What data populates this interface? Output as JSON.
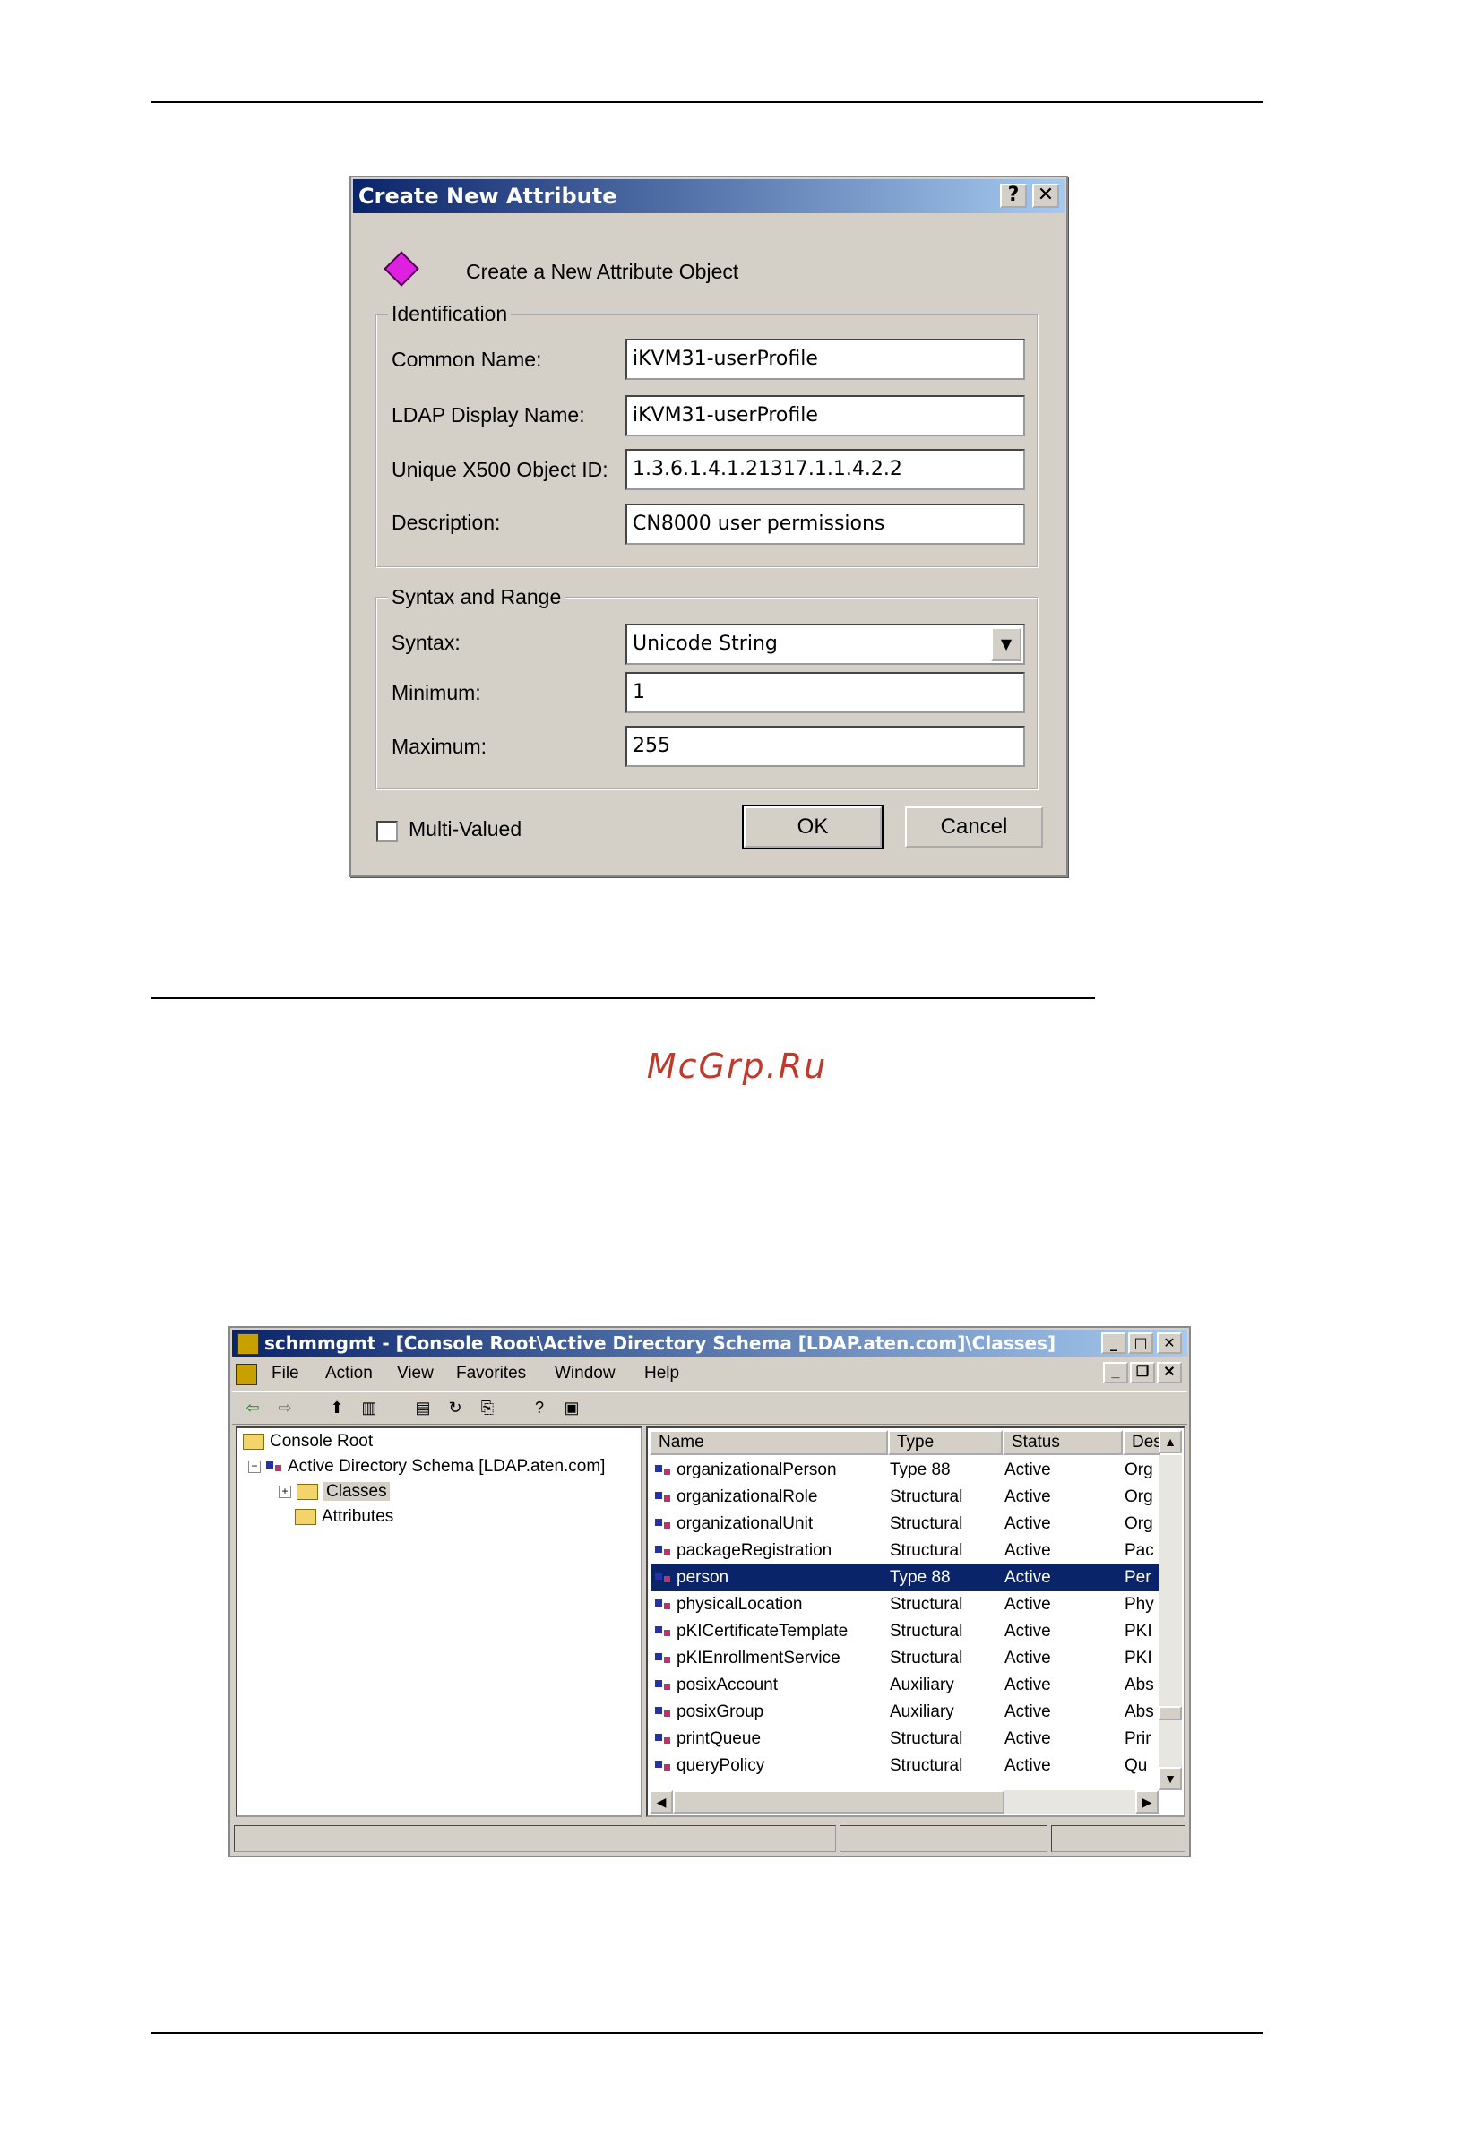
{
  "dialog": {
    "title": "Create New Attribute",
    "help_button": "?",
    "close_button": "✕",
    "header": "Create a New Attribute Object",
    "identification": {
      "legend": "Identification",
      "common_name_label": "Common Name:",
      "common_name_value": "iKVM31-userProfile",
      "ldap_display_label": "LDAP Display Name:",
      "ldap_display_value": "iKVM31-userProfile",
      "oid_label": "Unique X500 Object ID:",
      "oid_value": "1.3.6.1.4.1.21317.1.1.4.2.2",
      "description_label": "Description:",
      "description_value": "CN8000 user permissions"
    },
    "syntax_range": {
      "legend": "Syntax and Range",
      "syntax_label": "Syntax:",
      "syntax_value": "Unicode String",
      "minimum_label": "Minimum:",
      "minimum_value": "1",
      "maximum_label": "Maximum:",
      "maximum_value": "255"
    },
    "multi_valued_label": "Multi-Valued",
    "ok_label": "OK",
    "cancel_label": "Cancel"
  },
  "watermark": "McGrp.Ru",
  "mmc": {
    "title": "schmmgmt - [Console Root\\Active Directory Schema [LDAP.aten.com]\\Classes]",
    "menu": [
      "File",
      "Action",
      "View",
      "Favorites",
      "Window",
      "Help"
    ],
    "tree": {
      "root": "Console Root",
      "schema": "Active Directory Schema [LDAP.aten.com]",
      "classes": "Classes",
      "attributes": "Attributes"
    },
    "columns": [
      "Name",
      "Type",
      "Status",
      "Des"
    ],
    "rows": [
      {
        "name": "organizationalPerson",
        "type": "Type 88",
        "status": "Active",
        "desc": "Org"
      },
      {
        "name": "organizationalRole",
        "type": "Structural",
        "status": "Active",
        "desc": "Org"
      },
      {
        "name": "organizationalUnit",
        "type": "Structural",
        "status": "Active",
        "desc": "Org"
      },
      {
        "name": "packageRegistration",
        "type": "Structural",
        "status": "Active",
        "desc": "Pac"
      },
      {
        "name": "person",
        "type": "Type 88",
        "status": "Active",
        "desc": "Per"
      },
      {
        "name": "physicalLocation",
        "type": "Structural",
        "status": "Active",
        "desc": "Phy"
      },
      {
        "name": "pKICertificateTemplate",
        "type": "Structural",
        "status": "Active",
        "desc": "PKI"
      },
      {
        "name": "pKIEnrollmentService",
        "type": "Structural",
        "status": "Active",
        "desc": "PKI"
      },
      {
        "name": "posixAccount",
        "type": "Auxiliary",
        "status": "Active",
        "desc": "Abs"
      },
      {
        "name": "posixGroup",
        "type": "Auxiliary",
        "status": "Active",
        "desc": "Abs"
      },
      {
        "name": "printQueue",
        "type": "Structural",
        "status": "Active",
        "desc": "Prir"
      },
      {
        "name": "queryPolicy",
        "type": "Structural",
        "status": "Active",
        "desc": "Qu"
      }
    ],
    "selected_row": "person"
  }
}
